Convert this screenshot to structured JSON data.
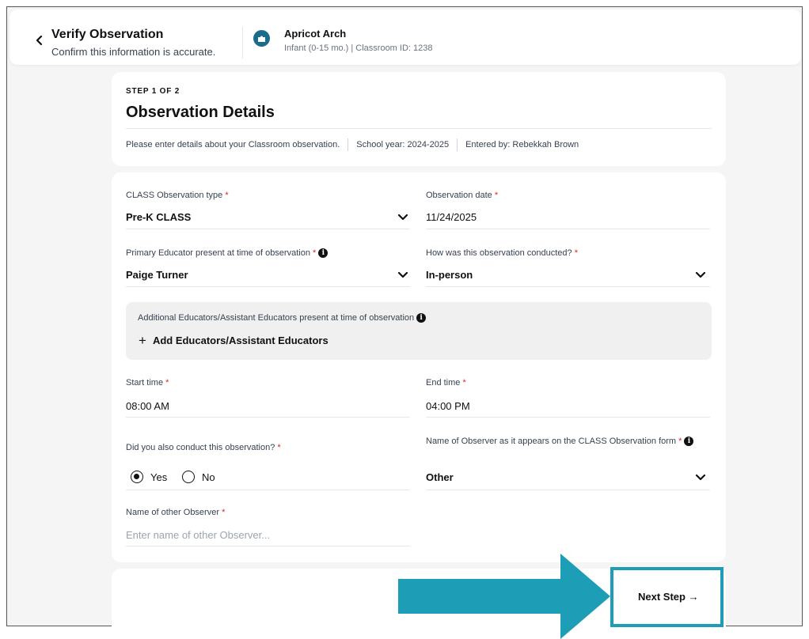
{
  "header": {
    "title": "Verify Observation",
    "subtitle": "Confirm this information is accurate.",
    "classroom_name": "Apricot Arch",
    "classroom_meta": "Infant (0-15 mo.) | Classroom ID: 1238"
  },
  "step_card": {
    "step": "STEP 1 OF 2",
    "title": "Observation Details",
    "meta": [
      "Please enter details about your Classroom observation.",
      "School year: 2024-2025",
      "Entered by: Rebekkah Brown"
    ]
  },
  "form": {
    "observation_type": {
      "label": "CLASS Observation type",
      "value": "Pre-K CLASS"
    },
    "observation_date": {
      "label": "Observation date",
      "value": "11/24/2025"
    },
    "primary_educator": {
      "label": "Primary Educator present at time of observation",
      "value": "Paige Turner"
    },
    "conducted": {
      "label": "How was this observation conducted?",
      "value": "In-person"
    },
    "additional": {
      "label": "Additional Educators/Assistant Educators present at time of observation",
      "button": "Add Educators/Assistant Educators"
    },
    "start_time": {
      "label": "Start time",
      "value": "08:00 AM"
    },
    "end_time": {
      "label": "End time",
      "value": "04:00 PM"
    },
    "also_conducted": {
      "label": "Did you also conduct this observation?",
      "yes": "Yes",
      "no": "No",
      "selected": "Yes"
    },
    "observer_name": {
      "label": "Name of Observer as it appears on the CLASS Observation form",
      "value": "Other"
    },
    "other_observer": {
      "label": "Name of other Observer",
      "placeholder": "Enter name of other Observer..."
    },
    "required_mark": "*"
  },
  "footer": {
    "next_label": "Next Step",
    "next_icon": "→"
  },
  "colors": {
    "highlight": "#1e9db6",
    "required": "#dc2626",
    "icon_bg": "#1b6b8a"
  },
  "icons": {
    "back": "chevron-left-icon",
    "dropdown": "chevron-down-icon",
    "info": "info-icon",
    "add": "plus-icon",
    "classroom": "puzzle-icon"
  }
}
